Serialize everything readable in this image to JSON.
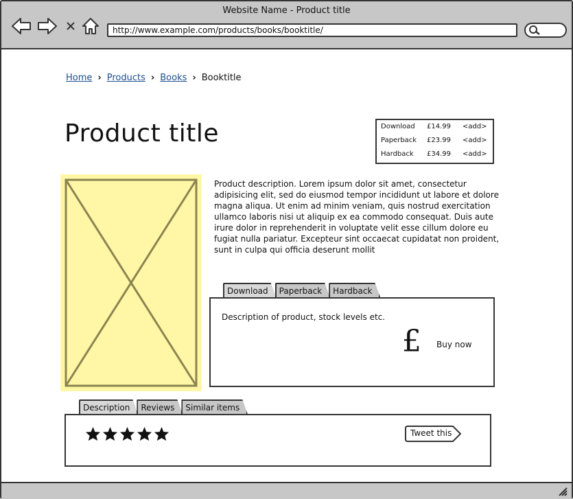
{
  "window": {
    "title": "Website Name - Product title"
  },
  "browser": {
    "url": "http://www.example.com/products/books/booktitle/"
  },
  "breadcrumb": {
    "home": "Home",
    "products": "Products",
    "books": "Books",
    "current": "Booktitle"
  },
  "product": {
    "title": "Product title",
    "description": "Product description. Lorem ipsum dolor sit amet, consectetur adipisicing elit, sed do eiusmod tempor incididunt ut labore et dolore magna aliqua. Ut enim ad minim veniam, quis nostrud exercitation ullamco laboris nisi ut aliquip ex ea commodo consequat. Duis aute irure dolor in reprehenderit in voluptate velit esse cillum dolore eu fugiat nulla pariatur. Excepteur sint occaecat cupidatat non proident, sunt in culpa qui officia deserunt mollit"
  },
  "prices": [
    {
      "format": "Download",
      "price": "£14.99",
      "action": "<add>"
    },
    {
      "format": "Paperback",
      "price": "£23.99",
      "action": "<add>"
    },
    {
      "format": "Hardback",
      "price": "£34.99",
      "action": "<add>"
    }
  ],
  "format_tabs": [
    "Download",
    "Paperback",
    "Hardback"
  ],
  "format_panel": {
    "text": "Description of product, stock levels etc.",
    "currency_symbol": "£",
    "buy_label": "Buy now"
  },
  "info_tabs": [
    "Description",
    "Reviews",
    "Similar items"
  ],
  "reviews": {
    "rating": 5,
    "max": 5
  },
  "tweet": {
    "label": "Tweet this"
  },
  "colors": {
    "chrome": "#c7c7c7",
    "image_placeholder": "#fff7a6",
    "link": "#1a4d8f"
  }
}
